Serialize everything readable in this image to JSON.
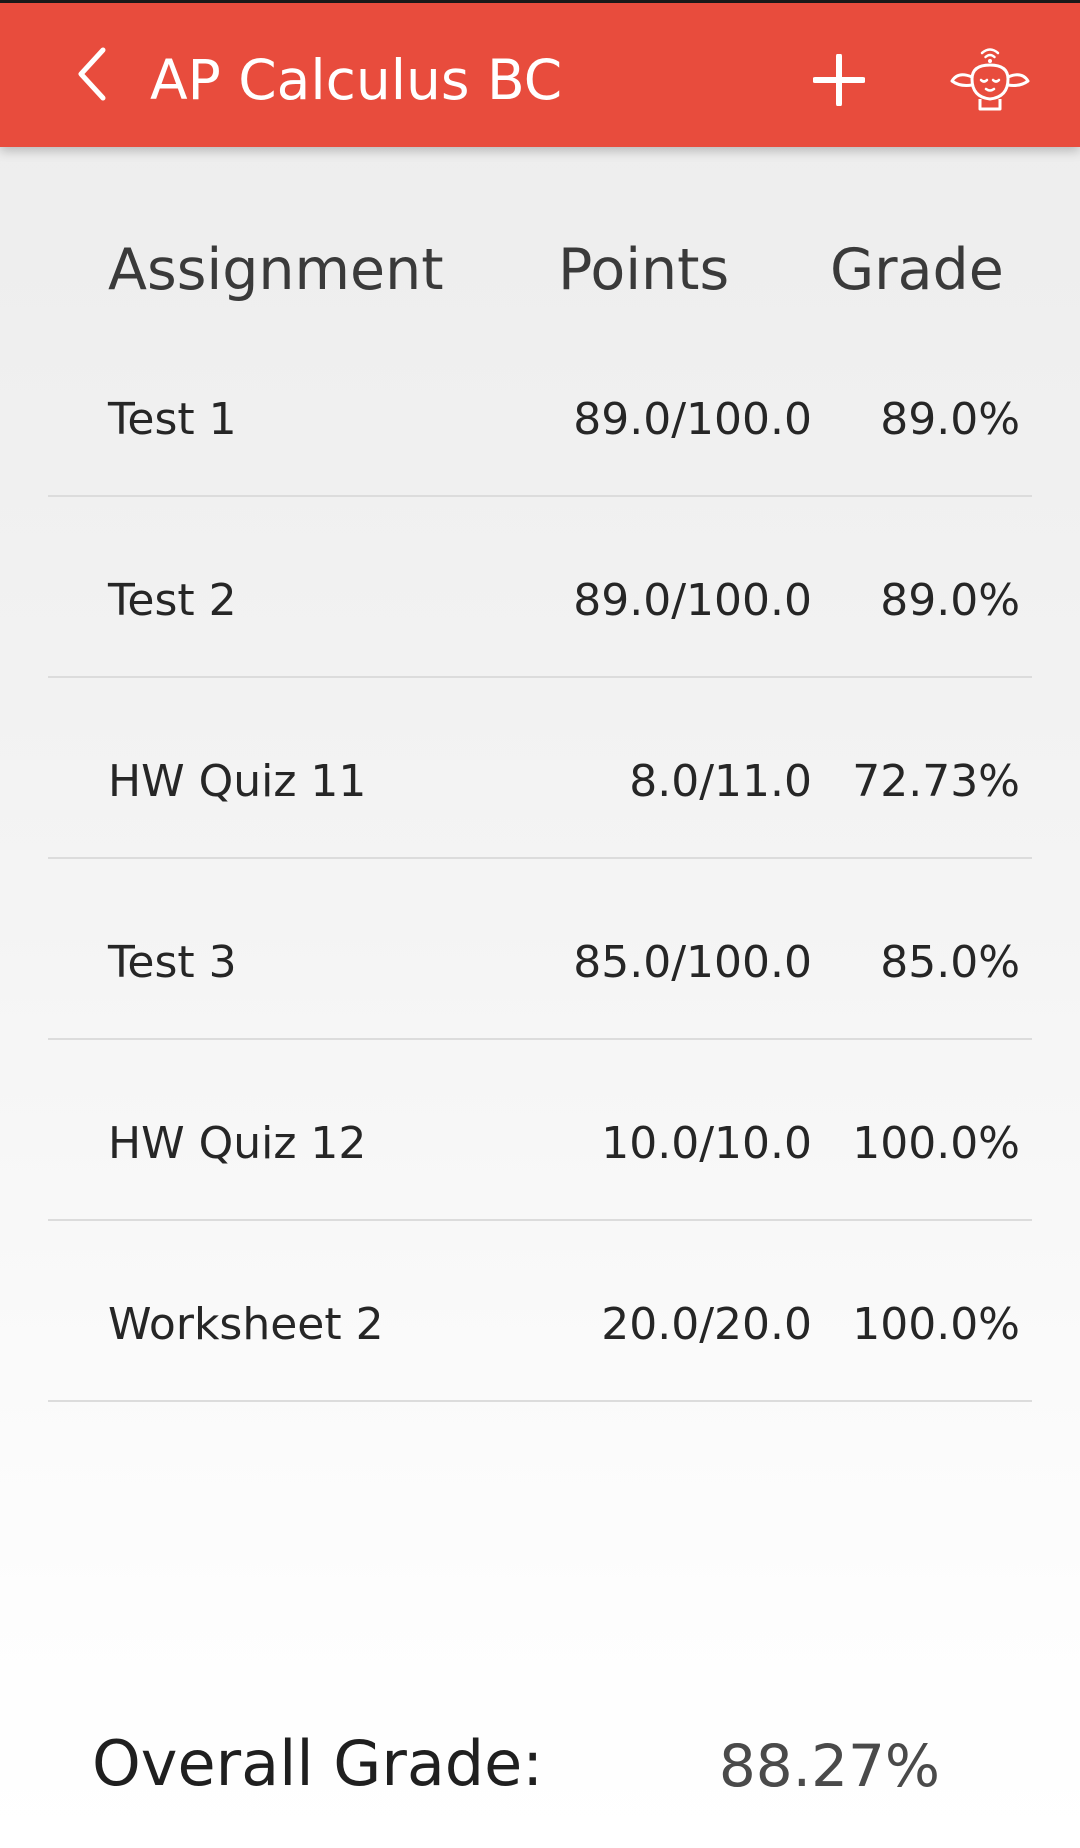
{
  "app_bar": {
    "title": "AP Calculus BC",
    "background_color": "#e84c3d",
    "back_icon": "chevron-left-icon",
    "add_icon": "plus-icon",
    "mascot_icon": "mascot-wifi-icon"
  },
  "table": {
    "headers": {
      "assignment": "Assignment",
      "points": "Points",
      "grade": "Grade"
    },
    "rows": [
      {
        "name": "Test 1",
        "points": "89.0/100.0",
        "grade": "89.0%"
      },
      {
        "name": "Test 2",
        "points": "89.0/100.0",
        "grade": "89.0%"
      },
      {
        "name": "HW Quiz 11",
        "points": "8.0/11.0",
        "grade": "72.73%"
      },
      {
        "name": "Test 3",
        "points": "85.0/100.0",
        "grade": "85.0%"
      },
      {
        "name": "HW Quiz 12",
        "points": "10.0/10.0",
        "grade": "100.0%"
      },
      {
        "name": "Worksheet 2",
        "points": "20.0/20.0",
        "grade": "100.0%"
      }
    ]
  },
  "overall": {
    "label": "Overall Grade:",
    "value": "88.27%"
  }
}
